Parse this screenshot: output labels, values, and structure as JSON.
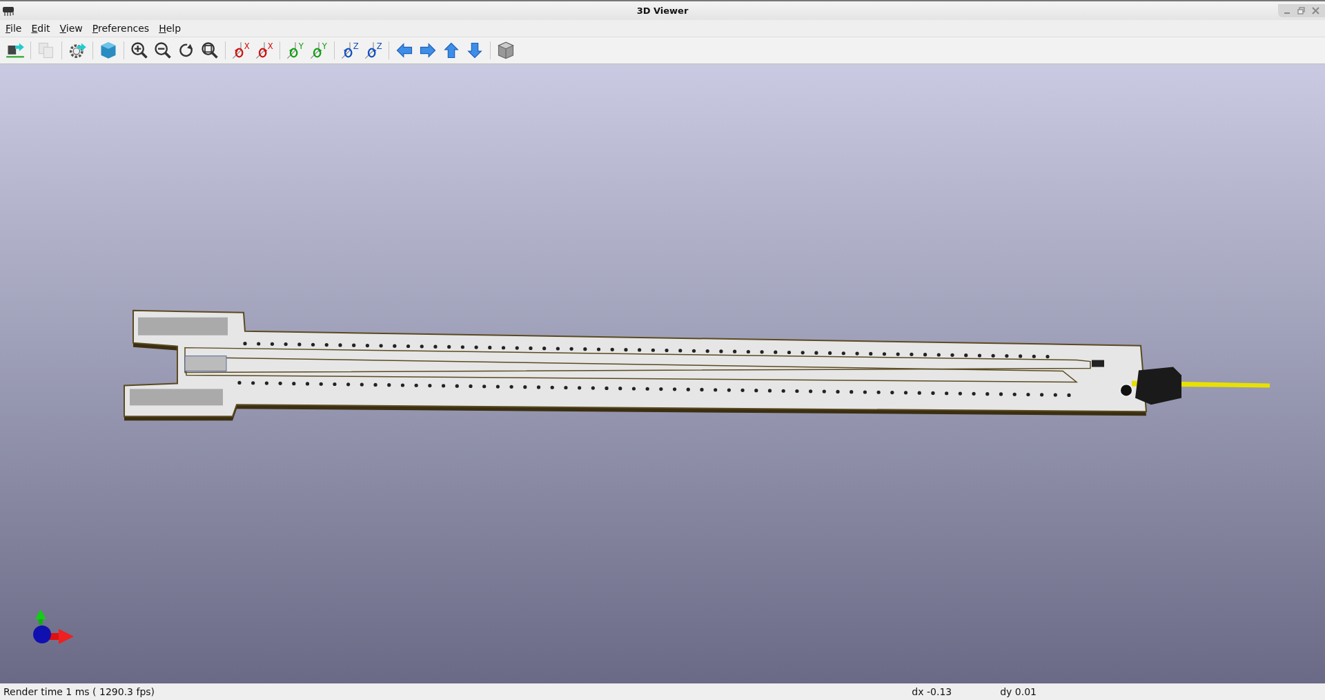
{
  "window": {
    "title": "3D Viewer"
  },
  "menu": [
    {
      "label": "File"
    },
    {
      "label": "Edit"
    },
    {
      "label": "View"
    },
    {
      "label": "Preferences"
    },
    {
      "label": "Help"
    }
  ],
  "toolbar": [
    {
      "kind": "reload",
      "disabled": false
    },
    {
      "kind": "copy",
      "disabled": true
    },
    {
      "kind": "settings",
      "disabled": false
    },
    {
      "kind": "cube-blue",
      "disabled": false
    },
    {
      "kind": "zoom-in",
      "disabled": false
    },
    {
      "kind": "zoom-out",
      "disabled": false
    },
    {
      "kind": "redraw",
      "disabled": false
    },
    {
      "kind": "zoom-fit",
      "disabled": false
    },
    {
      "kind": "rotate-x",
      "letter": "X",
      "disabled": false
    },
    {
      "kind": "rotate-x-reverse",
      "letter": "X",
      "disabled": false
    },
    {
      "kind": "rotate-y",
      "letter": "Y",
      "disabled": false
    },
    {
      "kind": "rotate-y-reverse",
      "letter": "Y",
      "disabled": false
    },
    {
      "kind": "rotate-z",
      "letter": "Z",
      "disabled": false
    },
    {
      "kind": "rotate-z-reverse",
      "letter": "Z",
      "disabled": false
    },
    {
      "kind": "arrow-left",
      "disabled": false
    },
    {
      "kind": "arrow-right",
      "disabled": false
    },
    {
      "kind": "arrow-up",
      "disabled": false
    },
    {
      "kind": "arrow-down",
      "disabled": false
    },
    {
      "kind": "cube-grey",
      "disabled": false
    }
  ],
  "status_bar": {
    "render": "Render time 1 ms ( 1290.3 fps)",
    "dx": "dx -0.13",
    "dy": "dy 0.01"
  }
}
